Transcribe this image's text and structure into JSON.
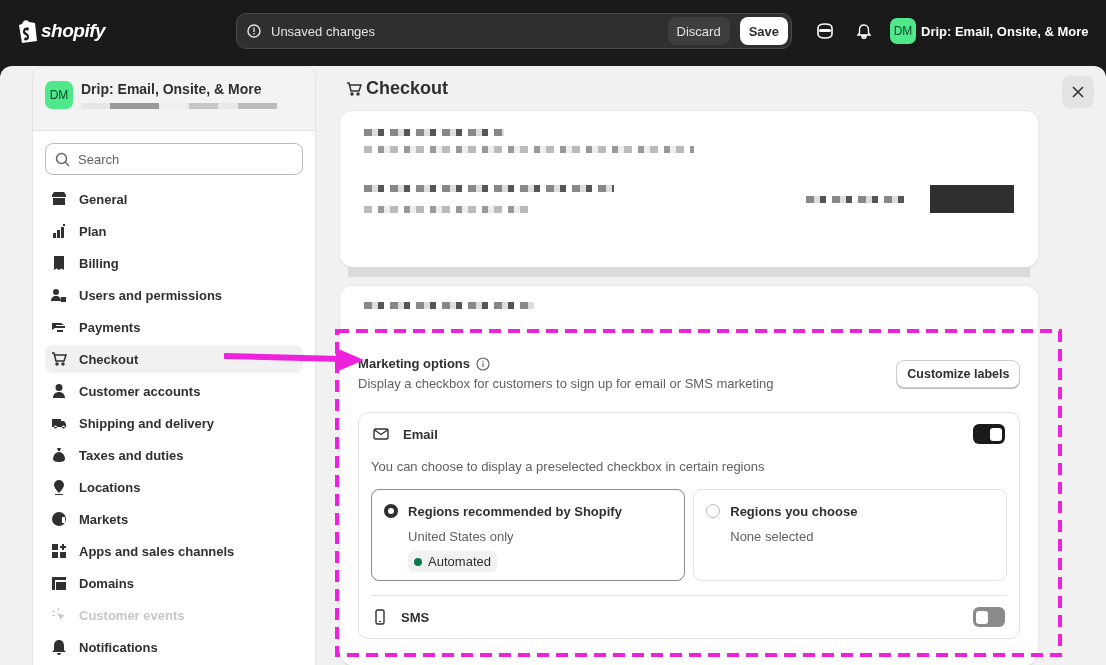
{
  "topbar": {
    "logo": "shopify",
    "message": "Unsaved changes",
    "buttons": [
      {
        "label": "Discard",
        "kind": "secondary"
      },
      {
        "label": "Save",
        "kind": "primary"
      }
    ],
    "store": {
      "initials": "DM",
      "name": "Drip: Email, Onsite, & More"
    }
  },
  "sidebar": {
    "store": {
      "initials": "DM",
      "name": "Drip: Email, Onsite, & More"
    },
    "search": {
      "placeholder": "Search"
    },
    "items": [
      {
        "label": "General",
        "selected": false,
        "disabled": false
      },
      {
        "label": "Plan",
        "selected": false,
        "disabled": false
      },
      {
        "label": "Billing",
        "selected": false,
        "disabled": false
      },
      {
        "label": "Users and permissions",
        "selected": false,
        "disabled": false
      },
      {
        "label": "Payments",
        "selected": false,
        "disabled": false
      },
      {
        "label": "Checkout",
        "selected": true,
        "disabled": false
      },
      {
        "label": "Customer accounts",
        "selected": false,
        "disabled": false
      },
      {
        "label": "Shipping and delivery",
        "selected": false,
        "disabled": false
      },
      {
        "label": "Taxes and duties",
        "selected": false,
        "disabled": false
      },
      {
        "label": "Locations",
        "selected": false,
        "disabled": false
      },
      {
        "label": "Markets",
        "selected": false,
        "disabled": false
      },
      {
        "label": "Apps and sales channels",
        "selected": false,
        "disabled": false
      },
      {
        "label": "Domains",
        "selected": false,
        "disabled": false
      },
      {
        "label": "Customer events",
        "selected": false,
        "disabled": true
      },
      {
        "label": "Notifications",
        "selected": false,
        "disabled": false
      }
    ]
  },
  "page": {
    "title": "Checkout"
  },
  "marketing": {
    "title": "Marketing options",
    "description": "Display a checkbox for customers to sign up for email or SMS marketing",
    "button": "Customize labels",
    "channels": [
      {
        "kind": "email",
        "label": "Email",
        "on": true,
        "note": "You can choose to display a preselected checkbox in certain regions",
        "options": [
          {
            "title": "Regions recommended by Shopify",
            "detail": "United States only",
            "badge": {
              "label": "Automated",
              "color": "#0c7a4f"
            },
            "selected": true
          },
          {
            "title": "Regions you choose",
            "detail": "None selected",
            "selected": false
          }
        ]
      },
      {
        "kind": "sms",
        "label": "SMS",
        "on": false
      }
    ]
  }
}
